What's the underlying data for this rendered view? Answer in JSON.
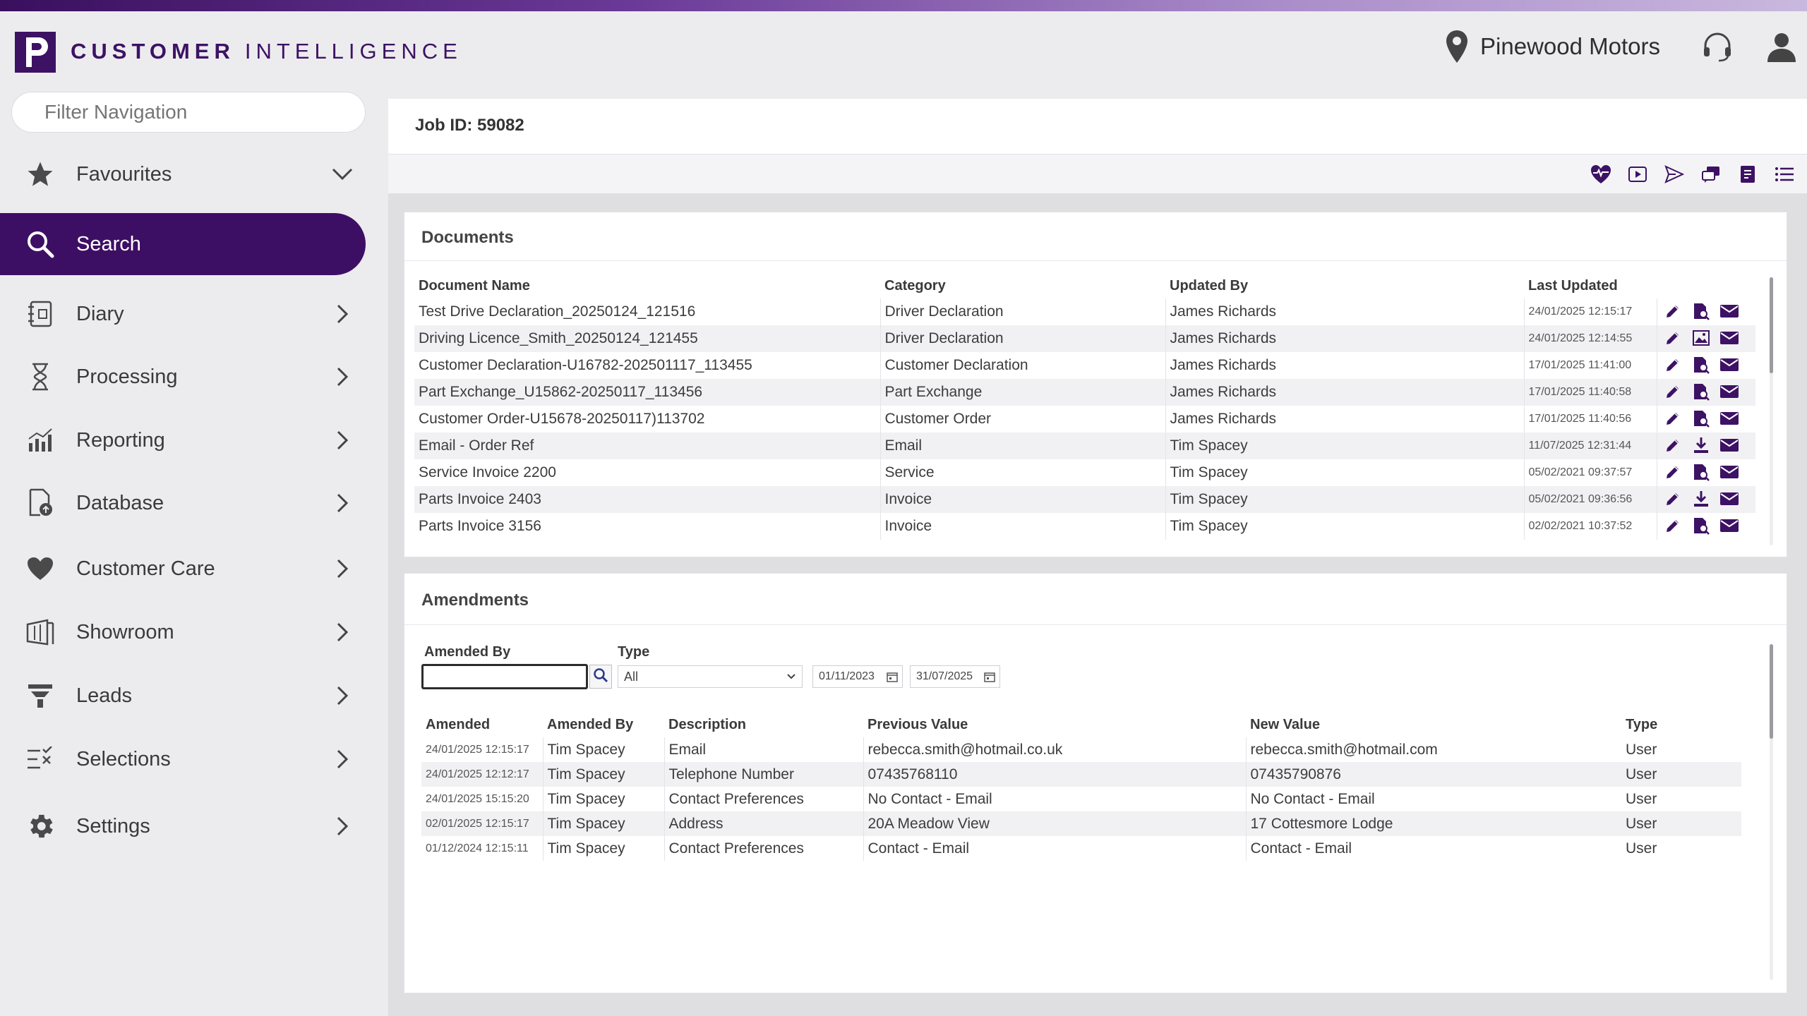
{
  "brand": {
    "logo_letter": "P",
    "name_bold": "CUSTOMER",
    "name_light": "INTELLIGENCE",
    "accent": "#3d1264"
  },
  "header": {
    "location_icon": "map-pin-icon",
    "company": "Pinewood Motors",
    "support_icon": "headset-icon",
    "user_icon": "user-icon"
  },
  "sidebar": {
    "filter_placeholder": "Filter Navigation",
    "items": [
      {
        "label": "Favourites",
        "icon": "star-icon",
        "chevron": "down"
      },
      {
        "label": "Search",
        "icon": "search-icon",
        "active": true
      },
      {
        "label": "Diary",
        "icon": "diary-icon",
        "chevron": "right"
      },
      {
        "label": "Processing",
        "icon": "hourglass-icon",
        "chevron": "right"
      },
      {
        "label": "Reporting",
        "icon": "bar-chart-icon",
        "chevron": "right"
      },
      {
        "label": "Database",
        "icon": "database-icon",
        "chevron": "right"
      },
      {
        "label": "Customer Care",
        "icon": "heart-icon",
        "chevron": "right"
      },
      {
        "label": "Showroom",
        "icon": "showroom-icon",
        "chevron": "right"
      },
      {
        "label": "Leads",
        "icon": "funnel-icon",
        "chevron": "right"
      },
      {
        "label": "Selections",
        "icon": "checklist-icon",
        "chevron": "right"
      },
      {
        "label": "Settings",
        "icon": "gear-icon",
        "chevron": "right"
      }
    ]
  },
  "job": {
    "title": "Job ID: 59082",
    "toolbar_icons": [
      "heart-pulse-icon",
      "play-icon",
      "send-icon",
      "chat-icon",
      "document-icon",
      "list-icon"
    ]
  },
  "documents": {
    "title": "Documents",
    "columns": [
      "Document Name",
      "Category",
      "Updated By",
      "Last Updated"
    ],
    "rows": [
      {
        "name": "Test Drive Declaration_20250124_121516",
        "category": "Driver Declaration",
        "by": "James Richards",
        "updated": "24/01/2025 12:15:17",
        "icons": [
          "edit-icon",
          "preview-icon",
          "email-icon"
        ]
      },
      {
        "name": "Driving Licence_Smith_20250124_121455",
        "category": "Driver Declaration",
        "by": "James Richards",
        "updated": "24/01/2025 12:14:55",
        "icons": [
          "edit-icon",
          "image-icon",
          "email-icon"
        ]
      },
      {
        "name": "Customer Declaration-U16782-202501117_113455",
        "category": "Customer Declaration",
        "by": "James Richards",
        "updated": "17/01/2025 11:41:00",
        "icons": [
          "edit-icon",
          "preview-icon",
          "email-icon"
        ]
      },
      {
        "name": "Part Exchange_U15862-20250117_113456",
        "category": "Part Exchange",
        "by": "James Richards",
        "updated": "17/01/2025 11:40:58",
        "icons": [
          "edit-icon",
          "preview-icon",
          "email-icon"
        ]
      },
      {
        "name": "Customer Order-U15678-20250117)113702",
        "category": "Customer Order",
        "by": "James Richards",
        "updated": "17/01/2025 11:40:56",
        "icons": [
          "edit-icon",
          "preview-icon",
          "email-icon"
        ]
      },
      {
        "name": "Email - Order Ref",
        "category": "Email",
        "by": "Tim Spacey",
        "updated": "11/07/2025 12:31:44",
        "icons": [
          "edit-icon",
          "download-icon",
          "email-icon"
        ]
      },
      {
        "name": "Service Invoice 2200",
        "category": "Service",
        "by": "Tim Spacey",
        "updated": "05/02/2021 09:37:57",
        "icons": [
          "edit-icon",
          "preview-icon",
          "email-icon"
        ]
      },
      {
        "name": "Parts Invoice 2403",
        "category": "Invoice",
        "by": "Tim Spacey",
        "updated": "05/02/2021 09:36:56",
        "icons": [
          "edit-icon",
          "download-icon",
          "email-icon"
        ]
      },
      {
        "name": "Parts Invoice 3156",
        "category": "Invoice",
        "by": "Tim Spacey",
        "updated": "02/02/2021 10:37:52",
        "icons": [
          "edit-icon",
          "preview-icon",
          "email-icon"
        ]
      }
    ]
  },
  "amendments": {
    "title": "Amendments",
    "filters": {
      "amended_by_label": "Amended By",
      "amended_by_value": "",
      "type_label": "Type",
      "type_value": "All",
      "date_from": "01/11/2023",
      "date_to": "31/07/2025"
    },
    "columns": [
      "Amended",
      "Amended By",
      "Description",
      "Previous Value",
      "New Value",
      "Type"
    ],
    "rows": [
      {
        "amended": "24/01/2025 12:15:17",
        "by": "Tim Spacey",
        "description": "Email",
        "previous": "rebecca.smith@hotmail.co.uk",
        "new": "rebecca.smith@hotmail.com",
        "type": "User"
      },
      {
        "amended": "24/01/2025 12:12:17",
        "by": "Tim Spacey",
        "description": "Telephone Number",
        "previous": "07435768110",
        "new": "07435790876",
        "type": "User"
      },
      {
        "amended": "24/01/2025 15:15:20",
        "by": "Tim Spacey",
        "description": "Contact Preferences",
        "previous": "No Contact - Email",
        "new": "No Contact - Email",
        "type": "User"
      },
      {
        "amended": "02/01/2025 12:15:17",
        "by": "Tim Spacey",
        "description": "Address",
        "previous": "20A Meadow View",
        "new": "17 Cottesmore Lodge",
        "type": "User"
      },
      {
        "amended": "01/12/2024 12:15:11",
        "by": "Tim Spacey",
        "description": "Contact Preferences",
        "previous": "Contact - Email",
        "new": "Contact - Email",
        "type": "User"
      }
    ]
  }
}
